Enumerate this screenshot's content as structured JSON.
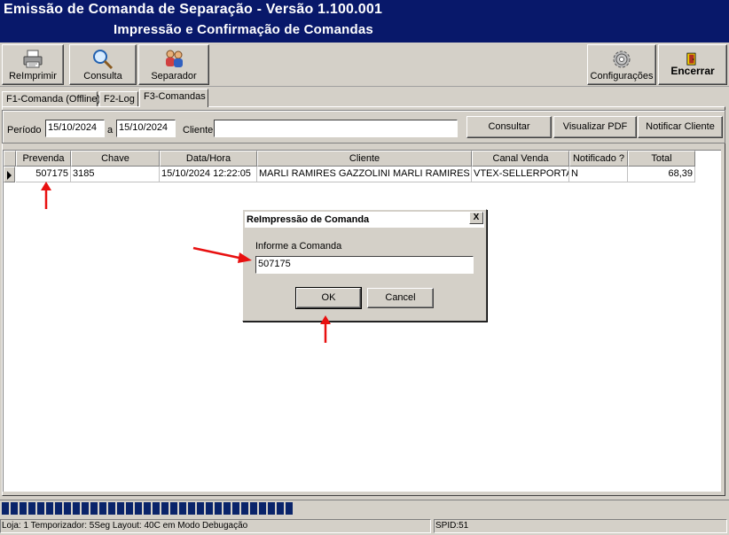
{
  "window": {
    "title": "Emissão de Comanda de Separação - Versão 1.100.001",
    "subtitle": "Impressão e Confirmação de Comandas"
  },
  "toolbar": {
    "reimprimir": "ReImprimir",
    "consulta": "Consulta",
    "separador": "Separador",
    "configuracoes": "Configurações",
    "encerrar": "Encerrar"
  },
  "tabs": [
    {
      "label": "F1-Comanda (Offline)"
    },
    {
      "label": "F2-Log"
    },
    {
      "label": "F3-Comandas"
    }
  ],
  "filters": {
    "periodo_label": "Período",
    "date_from": "15/10/2024",
    "a_label": "a",
    "date_to": "15/10/2024",
    "cliente_label": "Cliente",
    "cliente_value": "",
    "consultar": "Consultar",
    "visualizar_pdf": "Visualizar PDF",
    "notificar_cliente": "Notificar Cliente"
  },
  "grid": {
    "columns": [
      "Prevenda",
      "Chave",
      "Data/Hora",
      "Cliente",
      "Canal Venda",
      "Notificado ?",
      "Total"
    ],
    "rows": [
      [
        "507175",
        "3185",
        "15/10/2024 12:22:05",
        "MARLI RAMIRES GAZZOLINI MARLI RAMIRES GAZZOLINI",
        "VTEX-SELLERPORTAL",
        "N",
        "68,39"
      ]
    ]
  },
  "dialog": {
    "title": "ReImpressão de Comanda",
    "close": "X",
    "prompt": "Informe a Comanda",
    "value": "507175",
    "ok": "OK",
    "cancel": "Cancel"
  },
  "progress": {
    "blocks": 33
  },
  "status": {
    "left": "Loja: 1 Temporizador: 5Seg Layout: 40C em Modo Debugação",
    "right": "SPID:51"
  },
  "colors": {
    "titlebar": "#08186a",
    "progress": "#0a246a",
    "annotation_arrow": "#e81010"
  }
}
